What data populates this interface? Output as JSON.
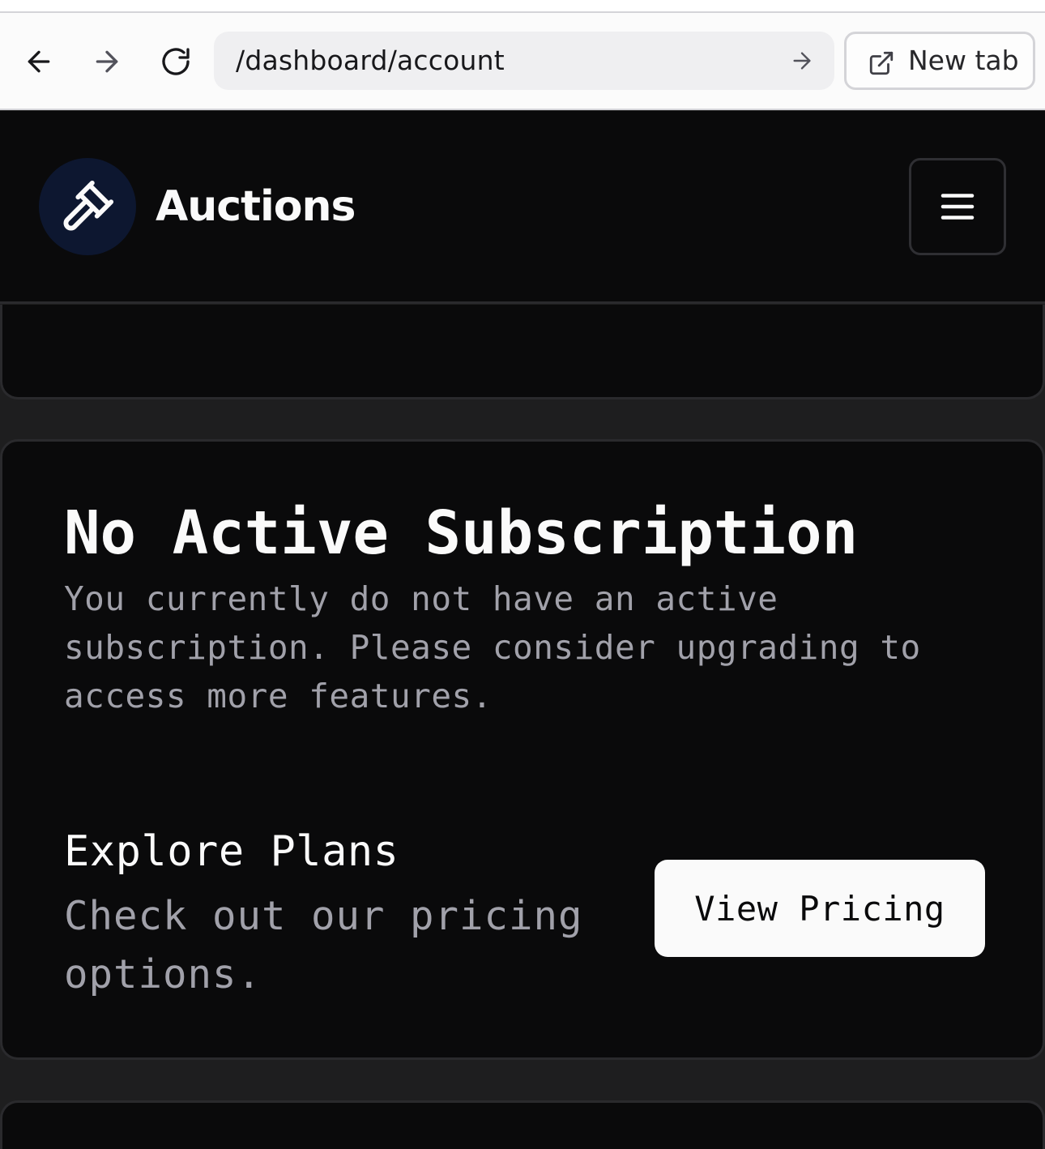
{
  "browser": {
    "url": "/dashboard/account",
    "new_tab_label": "New tab"
  },
  "header": {
    "brand": "Auctions",
    "logo_icon": "gavel-icon",
    "menu_icon": "hamburger-menu-icon"
  },
  "subscription": {
    "title": "No Active Subscription",
    "description": "You currently do not have an active subscription. Please consider upgrading to access more features.",
    "plans_heading": "Explore Plans",
    "plans_subtext": "Check out our pricing options.",
    "pricing_button": "View Pricing"
  },
  "colors": {
    "page_background": "#1e1e1f",
    "card_background": "#0a0a0b",
    "logo_circle": "#0d1730",
    "muted_text": "#a1a1aa",
    "primary_text": "#fafafa"
  }
}
